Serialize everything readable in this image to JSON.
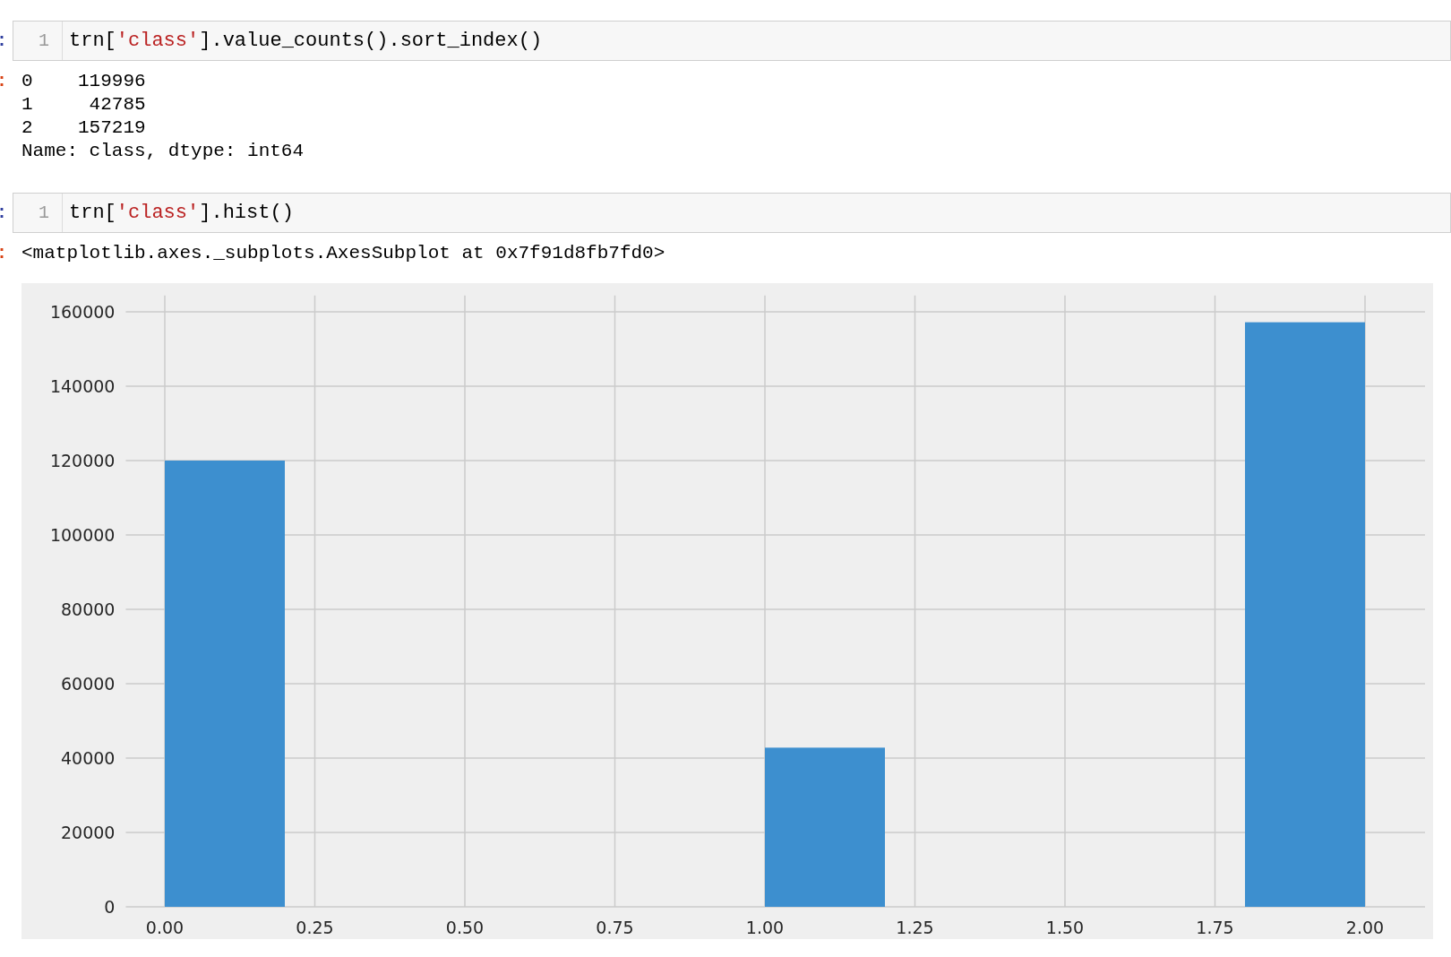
{
  "cells": [
    {
      "kind": "input",
      "prompt": ":",
      "line_number": "1",
      "code": [
        {
          "text": "trn[",
          "kind": "plain"
        },
        {
          "text": "'class'",
          "kind": "string"
        },
        {
          "text": "].value_counts().sort_index()",
          "kind": "plain"
        }
      ]
    },
    {
      "kind": "output",
      "prompt": ":",
      "lines": [
        "0    119996",
        "1     42785",
        "2    157219",
        "Name: class, dtype: int64"
      ]
    },
    {
      "kind": "input",
      "prompt": ":",
      "line_number": "1",
      "code": [
        {
          "text": "trn[",
          "kind": "plain"
        },
        {
          "text": "'class'",
          "kind": "string"
        },
        {
          "text": "].hist()",
          "kind": "plain"
        }
      ]
    },
    {
      "kind": "output",
      "prompt": ":",
      "lines": [
        "<matplotlib.axes._subplots.AxesSubplot at 0x7f91d8fb7fd0>"
      ],
      "chart_data": {
        "type": "bar",
        "grid": true,
        "x": [
          0.1,
          1.1,
          1.9
        ],
        "series": [
          {
            "color": "#3d8fcf",
            "values": [
              120000,
              42800,
              157200
            ]
          }
        ],
        "xlim": [
          -0.065,
          2.1
        ],
        "ylim": [
          0,
          164400
        ],
        "xticks": [
          {
            "value": 0,
            "label": "0.00"
          },
          {
            "value": 0.25,
            "label": "0.25"
          },
          {
            "value": 0.5,
            "label": "0.50"
          },
          {
            "value": 0.75,
            "label": "0.75"
          },
          {
            "value": 1,
            "label": "1.00"
          },
          {
            "value": 1.25,
            "label": "1.25"
          },
          {
            "value": 1.5,
            "label": "1.50"
          },
          {
            "value": 1.75,
            "label": "1.75"
          },
          {
            "value": 2,
            "label": "2.00"
          }
        ],
        "yticks": [
          0,
          20000,
          40000,
          60000,
          80000,
          100000,
          120000,
          140000,
          160000
        ]
      }
    }
  ]
}
